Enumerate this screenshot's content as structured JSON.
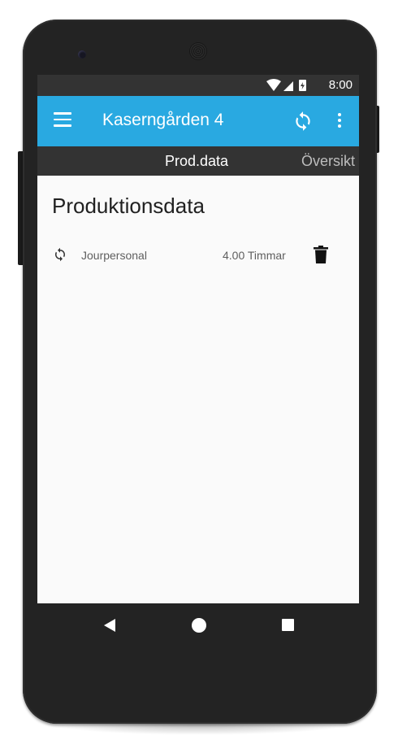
{
  "status_bar": {
    "time": "8:00"
  },
  "app_bar": {
    "title": "Kaserngården 4"
  },
  "tabs": [
    {
      "label": "Prod.data",
      "active": true
    },
    {
      "label": "Översikt",
      "active": false
    }
  ],
  "page": {
    "title": "Produktionsdata",
    "items": [
      {
        "name": "Jourpersonal",
        "value": "4.00 Timmar"
      }
    ]
  },
  "colors": {
    "accent": "#29a9e1",
    "status_bar": "#333333",
    "tab_bar": "#333333",
    "background": "#fafafa"
  },
  "icons": {
    "menu": "menu-icon",
    "sync": "sync-icon",
    "more": "more-vert-icon",
    "delete": "trash-icon",
    "add": "plus-icon",
    "nav_back": "back-triangle-icon",
    "nav_home": "home-circle-icon",
    "nav_recent": "recents-square-icon"
  }
}
